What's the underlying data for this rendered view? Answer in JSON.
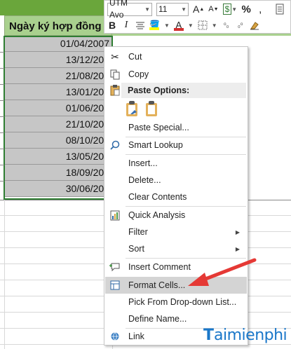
{
  "sheet": {
    "column_header": "Ngày ký hợp đồng",
    "dates": [
      "01/04/2007",
      "13/12/200",
      "21/08/200",
      "13/01/201",
      "01/06/201",
      "21/10/201",
      "08/10/201",
      "13/05/201",
      "18/09/201",
      "30/06/201"
    ]
  },
  "mini_toolbar": {
    "font_name": "UTM Avo",
    "font_size": "11",
    "grow_font": "A",
    "shrink_font": "A",
    "currency_symbol": "$",
    "percent": "%",
    "comma": ",",
    "bold": "B",
    "italic": "I",
    "font_color_letter": "A"
  },
  "context_menu": {
    "items": [
      {
        "label": "Cut",
        "icon": "scissors-icon"
      },
      {
        "label": "Copy",
        "icon": "copy-icon"
      },
      {
        "label": "Paste Options:",
        "icon": "paste-icon"
      },
      {
        "label": "Paste Special...",
        "icon": ""
      },
      {
        "label": "Smart Lookup",
        "icon": "smart-lookup-icon"
      },
      {
        "label": "Insert...",
        "icon": ""
      },
      {
        "label": "Delete...",
        "icon": ""
      },
      {
        "label": "Clear Contents",
        "icon": ""
      },
      {
        "label": "Quick Analysis",
        "icon": "quick-analysis-icon"
      },
      {
        "label": "Filter",
        "icon": "",
        "submenu": true
      },
      {
        "label": "Sort",
        "icon": "",
        "submenu": true
      },
      {
        "label": "Insert Comment",
        "icon": "insert-comment-icon"
      },
      {
        "label": "Format Cells...",
        "icon": "format-cells-icon",
        "highlighted": true
      },
      {
        "label": "Pick From Drop-down List...",
        "icon": ""
      },
      {
        "label": "Define Name...",
        "icon": ""
      },
      {
        "label": "Link",
        "icon": "link-icon"
      }
    ]
  },
  "watermark": {
    "text_a": "T",
    "text_b": "aimienphi"
  },
  "colors": {
    "header_green": "#a9d08e",
    "ribbon_green": "#6aa63b",
    "selection_gray": "#c6c6c6",
    "highlight_color": "#ffff00",
    "font_color": "#d32f2f",
    "arrow_red": "#e53935"
  }
}
